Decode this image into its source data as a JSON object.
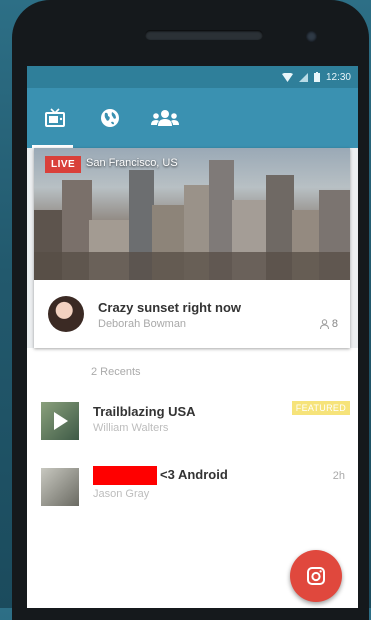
{
  "status_bar": {
    "time": "12:30"
  },
  "tabs": [
    {
      "name": "live-tv",
      "icon": "tv-icon",
      "selected": true
    },
    {
      "name": "global",
      "icon": "globe-icon",
      "selected": false
    },
    {
      "name": "people",
      "icon": "people-icon",
      "selected": false
    }
  ],
  "live_stream": {
    "badge": "LIVE",
    "location": "San Francisco, US",
    "title": "Crazy sunset right now",
    "streamer": "Deborah Bowman",
    "viewers": "8"
  },
  "recents": {
    "header": "2 Recents",
    "items": [
      {
        "title": "Trailblazing USA",
        "subtitle": "William Walters",
        "badge": "FEATURED"
      },
      {
        "title": "<3 Android",
        "subtitle": "Jason Gray",
        "time": "2h"
      }
    ]
  },
  "colors": {
    "primary": "#3a91b1",
    "status_bar": "#2f7f9a",
    "live_red": "#d9403a",
    "featured_yellow": "#f6e37a",
    "fab_red": "#e0483d"
  },
  "fab": {
    "icon": "camera-icon"
  }
}
